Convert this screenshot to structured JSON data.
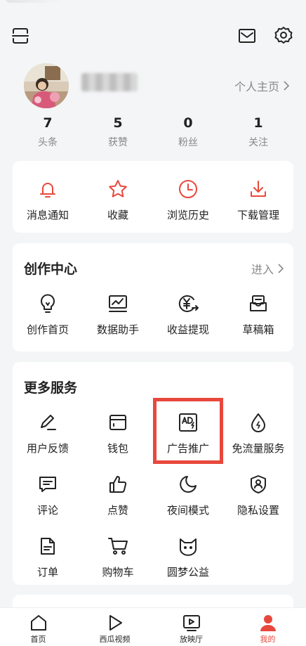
{
  "profile": {
    "home_link": "个人主页",
    "stats": [
      {
        "value": "7",
        "label": "头条"
      },
      {
        "value": "5",
        "label": "获赞"
      },
      {
        "value": "0",
        "label": "粉丝"
      },
      {
        "value": "1",
        "label": "关注"
      }
    ]
  },
  "quick": [
    {
      "label": "消息通知",
      "icon": "bell-icon"
    },
    {
      "label": "收藏",
      "icon": "star-icon"
    },
    {
      "label": "浏览历史",
      "icon": "clock-icon"
    },
    {
      "label": "下载管理",
      "icon": "download-icon"
    }
  ],
  "creation": {
    "title": "创作中心",
    "enter": "进入",
    "items": [
      {
        "label": "创作首页",
        "icon": "lightbulb-icon"
      },
      {
        "label": "数据助手",
        "icon": "chart-icon"
      },
      {
        "label": "收益提现",
        "icon": "yen-icon"
      },
      {
        "label": "草稿箱",
        "icon": "draft-icon"
      }
    ]
  },
  "services": {
    "title": "更多服务",
    "items": [
      {
        "label": "用户反馈",
        "icon": "pen-icon"
      },
      {
        "label": "钱包",
        "icon": "wallet-icon"
      },
      {
        "label": "广告推广",
        "icon": "ad-icon"
      },
      {
        "label": "免流量服务",
        "icon": "drop-bolt-icon"
      },
      {
        "label": "评论",
        "icon": "comment-icon"
      },
      {
        "label": "点赞",
        "icon": "thumb-up-icon"
      },
      {
        "label": "夜间模式",
        "icon": "moon-icon"
      },
      {
        "label": "隐私设置",
        "icon": "shield-user-icon"
      },
      {
        "label": "订单",
        "icon": "document-icon"
      },
      {
        "label": "购物车",
        "icon": "cart-icon"
      },
      {
        "label": "圆梦公益",
        "icon": "cat-icon"
      }
    ]
  },
  "tabs": [
    {
      "label": "首页",
      "icon": "home-icon"
    },
    {
      "label": "西瓜视频",
      "icon": "play-icon"
    },
    {
      "label": "放映厅",
      "icon": "tv-play-icon"
    },
    {
      "label": "我的",
      "icon": "person-icon"
    }
  ],
  "colors": {
    "accent": "#e8483c",
    "background": "#f4f5f6"
  }
}
